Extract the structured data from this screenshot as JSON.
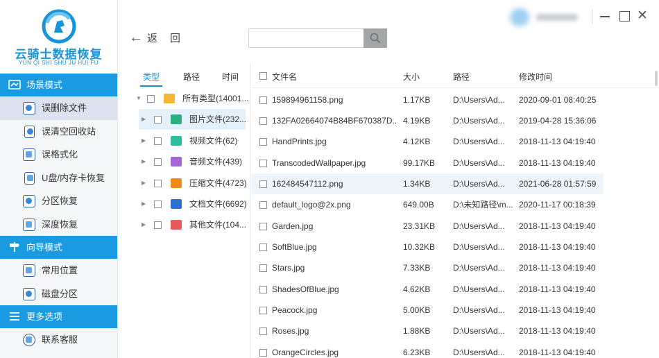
{
  "app": {
    "logo_cn": "云骑士数据恢复",
    "logo_en": "YUN QI SHI SHU JU HUI FU"
  },
  "sidebar": {
    "sections": [
      {
        "title": "场景模式",
        "items": [
          "误删除文件",
          "误清空回收站",
          "误格式化",
          "U盘/内存卡恢复",
          "分区恢复",
          "深度恢复"
        ]
      },
      {
        "title": "向导模式",
        "items": [
          "常用位置",
          "磁盘分区"
        ]
      },
      {
        "title": "更多选项",
        "items": [
          "联系客服"
        ]
      }
    ],
    "active_item": "误删除文件"
  },
  "topbar": {
    "back_label": "返",
    "back_label2": "回",
    "search_placeholder": ""
  },
  "tree": {
    "tabs": [
      "类型",
      "路径",
      "时间"
    ],
    "nodes": [
      {
        "label": "所有类型(14001...",
        "icon": "folder-icon",
        "color": "#f5b731"
      },
      {
        "label": "图片文件(232...",
        "icon": "image-icon",
        "color": "#2bb07f"
      },
      {
        "label": "视频文件(62)",
        "icon": "video-icon",
        "color": "#2bbfa0"
      },
      {
        "label": "音频文件(439)",
        "icon": "audio-icon",
        "color": "#a566d6"
      },
      {
        "label": "压缩文件(4723)",
        "icon": "archive-icon",
        "color": "#f08a1c"
      },
      {
        "label": "文档文件(6692)",
        "icon": "document-icon",
        "color": "#2f6fd1"
      },
      {
        "label": "其他文件(104...",
        "icon": "other-files-icon",
        "color": "#e85a5a"
      }
    ]
  },
  "files": {
    "columns": [
      "文件名",
      "大小",
      "路径",
      "修改时间"
    ],
    "rows": [
      {
        "name": "159894961158.png",
        "size": "1.17KB",
        "path": "D:\\Users\\Ad...",
        "time": "2020-09-01 08:40:25"
      },
      {
        "name": "132FA02664074B84BF670387D...",
        "size": "4.19KB",
        "path": "D:\\Users\\Ad...",
        "time": "2019-04-28 15:36:06"
      },
      {
        "name": "HandPrints.jpg",
        "size": "4.12KB",
        "path": "D:\\Users\\Ad...",
        "time": "2018-11-13 04:19:40"
      },
      {
        "name": "TranscodedWallpaper.jpg",
        "size": "99.17KB",
        "path": "D:\\Users\\Ad...",
        "time": "2018-11-13 04:19:40"
      },
      {
        "name": "162484547112.png",
        "size": "1.34KB",
        "path": "D:\\Users\\Ad...",
        "time": "2021-06-28 01:57:59"
      },
      {
        "name": "default_logo@2x.png",
        "size": "649.00B",
        "path": "D:\\未知路径\\m...",
        "time": "2020-11-17 00:18:39"
      },
      {
        "name": "Garden.jpg",
        "size": "23.31KB",
        "path": "D:\\Users\\Ad...",
        "time": "2018-11-13 04:19:40"
      },
      {
        "name": "SoftBlue.jpg",
        "size": "10.32KB",
        "path": "D:\\Users\\Ad...",
        "time": "2018-11-13 04:19:40"
      },
      {
        "name": "Stars.jpg",
        "size": "7.33KB",
        "path": "D:\\Users\\Ad...",
        "time": "2018-11-13 04:19:40"
      },
      {
        "name": "ShadesOfBlue.jpg",
        "size": "4.62KB",
        "path": "D:\\Users\\Ad...",
        "time": "2018-11-13 04:19:40"
      },
      {
        "name": "Peacock.jpg",
        "size": "5.00KB",
        "path": "D:\\Users\\Ad...",
        "time": "2018-11-13 04:19:40"
      },
      {
        "name": "Roses.jpg",
        "size": "1.88KB",
        "path": "D:\\Users\\Ad...",
        "time": "2018-11-13 04:19:40"
      },
      {
        "name": "OrangeCircles.jpg",
        "size": "6.23KB",
        "path": "D:\\Users\\Ad...",
        "time": "2018-11-13 04:19:40"
      }
    ],
    "highlighted_row": 4
  },
  "colors": {
    "accent": "#1a9ae0",
    "selected_bg": "#e4f1fb"
  }
}
